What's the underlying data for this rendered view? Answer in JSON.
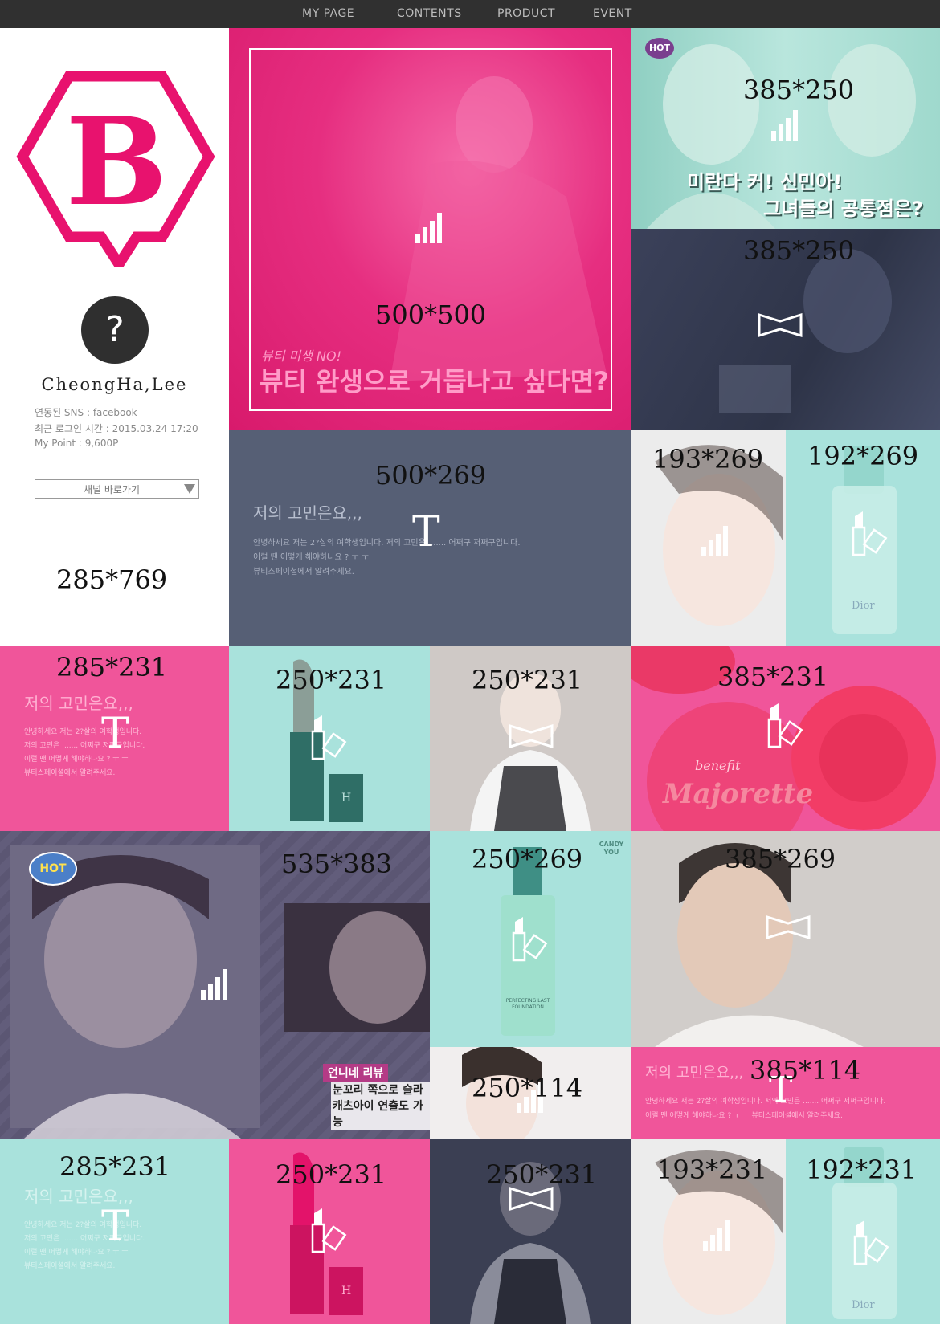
{
  "nav": {
    "items": [
      "MY PAGE",
      "CONTENTS",
      "PRODUCT",
      "EVENT"
    ]
  },
  "brand": {
    "logo_letter": "B",
    "color": "#e8126e"
  },
  "profile": {
    "avatar_symbol": "?",
    "name": "CheongHa,Lee",
    "sns": "연동된 SNS : facebook",
    "last_login": "최근 로그인 시간 : 2015.03.24 17:20",
    "points": "My Point : 9,600P",
    "channel_select": "채널 바로가기",
    "size_label": "285*769"
  },
  "tiles": {
    "t500x500": {
      "label": "500*500",
      "caption_small": "뷰티 미생 NO!",
      "caption_big": "뷰티 완생으로 거듭나고 싶다면?"
    },
    "t385x250a": {
      "label": "385*250",
      "hot": "HOT",
      "caption1": "미란다 커! 신민아!",
      "caption2": "그녀들의 공통점은?"
    },
    "t385x250b": {
      "label": "385*250"
    },
    "t500x269": {
      "label": "500*269",
      "title": "저의 고민은요,,,",
      "line1": "안녕하세요 저는 2?살의 여학생입니다. 저의 고민은 ....... 어쩌구 저쩌구입니다.",
      "line2": "이럴 땐 어떻게 해야하나요 ? ㅜ ㅜ",
      "line3": "뷰티스페이셜에서 알려주세요."
    },
    "t193x269a": {
      "label": "193*269"
    },
    "t192x269a": {
      "label": "192*269",
      "brand": "Dior"
    },
    "t285x231a": {
      "label": "285*231",
      "title": "저의 고민은요,,,",
      "line1": "안녕하세요 저는 2?살의 여학생입니다.",
      "line2": "저의 고민은 ....... 어쩌구 저쩌구입니다.",
      "line3": "이럴 땐 어떻게 해야하나요 ? ㅜ ㅜ",
      "line4": "뷰티스페이셜에서 알려주세요."
    },
    "t250x231a": {
      "label": "250*231",
      "mark": "H"
    },
    "t250x231b": {
      "label": "250*231"
    },
    "t385x231a": {
      "label": "385*231",
      "brand": "benefit",
      "product": "Majorette"
    },
    "t535x383": {
      "label": "535*383",
      "hot": "HOT",
      "review_tag": "언니네 리뷰",
      "review1": "눈꼬리 쪽으로 슬라이",
      "review2": "캐츠아이 연출도 가능"
    },
    "t250x269": {
      "label": "250*269",
      "badge": "CANDY YOU",
      "product": "PERFECTING LAST FOUNDATION"
    },
    "t385x269": {
      "label": "385*269"
    },
    "t250x114": {
      "label": "250*114"
    },
    "t385x114": {
      "label": "385*114",
      "title": "저의 고민은요,,,",
      "line1": "안녕하세요 저는 2?살의 여학생입니다. 저의 고민은 ....... 어쩌구 저쩌구입니다.",
      "line2": "이럴 땐 어떻게 해야하나요 ? ㅜ ㅜ 뷰티스페이셜에서 알려주세요."
    },
    "t285x231b": {
      "label": "285*231",
      "title": "저의 고민은요,,,",
      "line1": "안녕하세요 저는 2?살의 여학생입니다.",
      "line2": "저의 고민은 ....... 어쩌구 저쩌구입니다.",
      "line3": "이럴 땐 어떻게 해야하나요 ? ㅜ ㅜ",
      "line4": "뷰티스페이셜에서 알려주세요."
    },
    "t250x231c": {
      "label": "250*231",
      "mark": "H"
    },
    "t250x231d": {
      "label": "250*231"
    },
    "t193x231": {
      "label": "193*231"
    },
    "t192x231": {
      "label": "192*231",
      "brand": "Dior"
    }
  },
  "colors": {
    "pink": "#f0559a",
    "hot_pink": "#e8126e",
    "mint": "#a9e2dc",
    "slate": "#5a6478",
    "navy": "#2f3448",
    "purple_gray": "#5f5a77"
  }
}
